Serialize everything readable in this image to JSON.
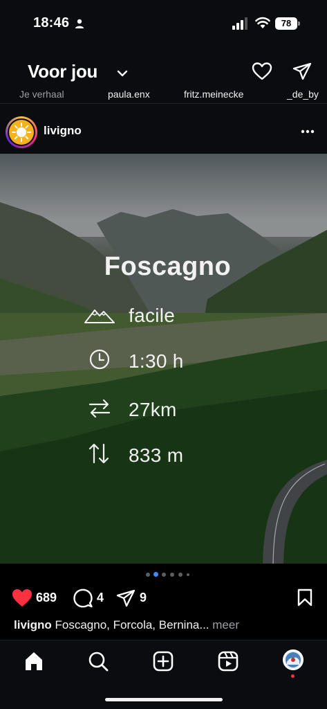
{
  "status_bar": {
    "time": "18:46",
    "battery": "78"
  },
  "header": {
    "title": "Voor jou"
  },
  "stories": [
    {
      "label": "Je verhaal"
    },
    {
      "label": "paula.enx"
    },
    {
      "label": "fritz.meinecke"
    },
    {
      "label": "_de_by"
    }
  ],
  "post": {
    "username": "livigno",
    "image": {
      "title": "Foscagno",
      "difficulty": "facile",
      "duration": "1:30 h",
      "distance": "27km",
      "elevation": "833 m"
    },
    "likes": "689",
    "comments": "4",
    "shares": "9",
    "caption_user": "livigno",
    "caption_text": "Foscagno, Forcola, Bernina...",
    "caption_more": "meer",
    "carousel_active_index": 1,
    "carousel_count": 6
  },
  "colors": {
    "background": "#0a0c0f",
    "like_red": "#ff3040",
    "carousel_active": "#3d8af7"
  },
  "icons": {
    "status": [
      "person-icon",
      "signal-icon",
      "wifi-icon",
      "battery-icon"
    ],
    "header": [
      "chevron-down-icon",
      "heart-icon",
      "send-icon"
    ],
    "post_header": [
      "more-icon"
    ],
    "stats": [
      "mountain-icon",
      "clock-icon",
      "arrows-horizontal-icon",
      "arrows-vertical-icon"
    ],
    "actions": [
      "heart-filled-icon",
      "comment-icon",
      "share-icon",
      "bookmark-icon"
    ],
    "tabs": [
      "home-icon",
      "search-icon",
      "create-icon",
      "reels-icon",
      "profile-avatar"
    ]
  }
}
